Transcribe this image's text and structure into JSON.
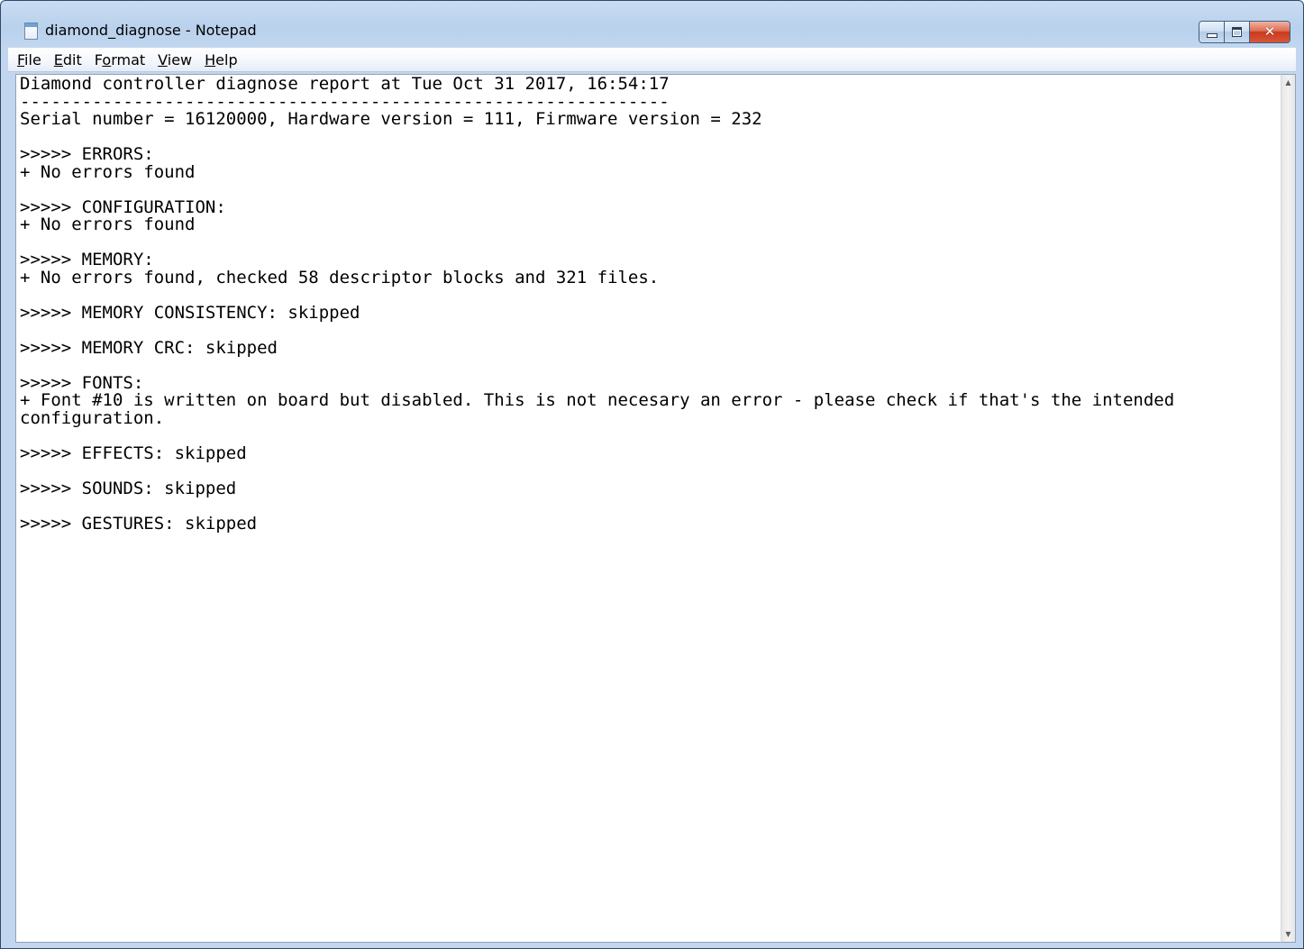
{
  "window": {
    "title": "diamond_diagnose - Notepad",
    "icon": "notepad-icon",
    "buttons": {
      "minimize": "minimize-icon",
      "maximize": "maximize-icon",
      "close": "close-icon"
    }
  },
  "menu": {
    "file": {
      "acc": "F",
      "rest": "ile"
    },
    "edit": {
      "acc": "E",
      "rest": "dit"
    },
    "format": {
      "pre": "F",
      "acc": "o",
      "rest": "rmat"
    },
    "view": {
      "acc": "V",
      "rest": "iew"
    },
    "help": {
      "acc": "H",
      "rest": "elp"
    }
  },
  "document": {
    "text": "Diamond controller diagnose report at Tue Oct 31 2017, 16:54:17\n---------------------------------------------------------------\nSerial number = 16120000, Hardware version = 111, Firmware version = 232\n\n>>>>> ERRORS:\n+ No errors found\n\n>>>>> CONFIGURATION:\n+ No errors found\n\n>>>>> MEMORY:\n+ No errors found, checked 58 descriptor blocks and 321 files.\n\n>>>>> MEMORY CONSISTENCY: skipped\n\n>>>>> MEMORY CRC: skipped\n\n>>>>> FONTS:\n+ Font #10 is written on board but disabled. This is not necesary an error - please check if that's the intended configuration.\n\n>>>>> EFFECTS: skipped\n\n>>>>> SOUNDS: skipped\n\n>>>>> GESTURES: skipped"
  }
}
